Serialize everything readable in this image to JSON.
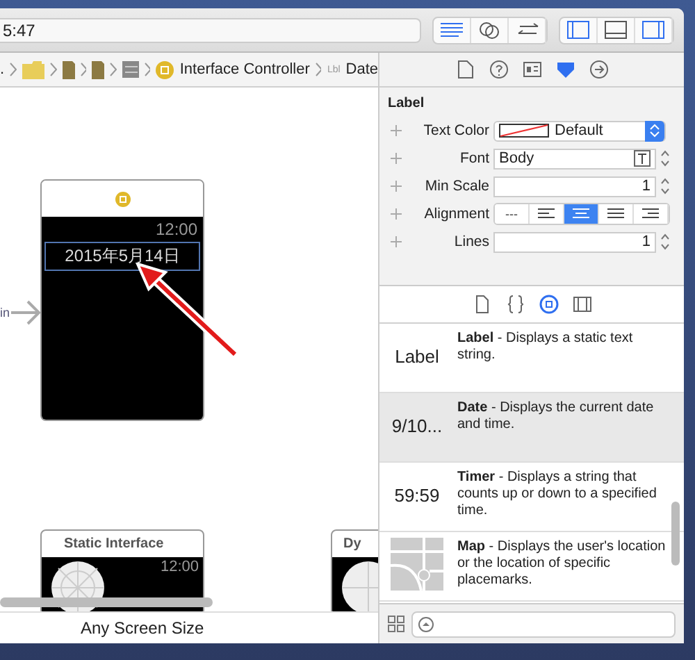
{
  "toolbar": {
    "activity_text": "5:47",
    "editor_buttons": [
      {
        "kind": "standard",
        "selected": true
      },
      {
        "kind": "assistant",
        "selected": false
      },
      {
        "kind": "version",
        "selected": false
      }
    ],
    "view_buttons": [
      {
        "kind": "navigator",
        "on": true
      },
      {
        "kind": "debug",
        "on": false
      },
      {
        "kind": "utilities",
        "on": true
      }
    ]
  },
  "jump_bar": {
    "items": [
      {
        "kind": "text",
        "label": "."
      },
      {
        "kind": "folder"
      },
      {
        "kind": "file"
      },
      {
        "kind": "file"
      },
      {
        "kind": "storyboard"
      },
      {
        "kind": "controller",
        "label": "Interface Controller"
      },
      {
        "kind": "element",
        "badge": "Lbl",
        "label": "Date"
      }
    ]
  },
  "canvas": {
    "entry_label": "in",
    "scene": {
      "time": "12:00",
      "date_label": "2015年5月14日",
      "label_selected": true
    },
    "static_card": {
      "title": "Static Interface",
      "time": "12:00"
    },
    "dynamic_card": {
      "title": "Dy"
    },
    "footer": "Any Screen Size"
  },
  "inspector": {
    "tabs": [
      {
        "kind": "file",
        "selected": false
      },
      {
        "kind": "help",
        "selected": false
      },
      {
        "kind": "identity",
        "selected": false
      },
      {
        "kind": "attributes",
        "selected": true
      },
      {
        "kind": "connections",
        "selected": false
      }
    ],
    "section": "Label",
    "rows": [
      {
        "kind": "color",
        "label": "Text Color",
        "value": "Default"
      },
      {
        "kind": "font",
        "label": "Font",
        "value": "Body"
      },
      {
        "kind": "stepper",
        "label": "Min Scale",
        "value": "1"
      },
      {
        "kind": "segmented",
        "label": "Alignment",
        "segments": [
          {
            "kind": "natural",
            "text": "---",
            "selected": false
          },
          {
            "kind": "left",
            "selected": false
          },
          {
            "kind": "center",
            "selected": true
          },
          {
            "kind": "justified",
            "selected": false
          },
          {
            "kind": "right",
            "selected": false
          }
        ]
      },
      {
        "kind": "stepper",
        "label": "Lines",
        "value": "1"
      }
    ]
  },
  "library": {
    "tabs": [
      {
        "kind": "file",
        "selected": false
      },
      {
        "kind": "code",
        "selected": false
      },
      {
        "kind": "object",
        "selected": true
      },
      {
        "kind": "media",
        "selected": false
      }
    ],
    "items": [
      {
        "kind": "text",
        "preview": "Label",
        "description": "**Label** - Displays a static text string.",
        "selected": false
      },
      {
        "kind": "text",
        "preview": "9/10...",
        "description": "**Date** - Displays the current date and time.",
        "selected": true
      },
      {
        "kind": "text",
        "preview": "59:59",
        "description": "**Timer** - Displays a string that counts up or down to a specified time.",
        "selected": false
      },
      {
        "kind": "map",
        "description": "**Map** - Displays the user's location or the location of specific placemarks.",
        "selected": false
      }
    ]
  }
}
